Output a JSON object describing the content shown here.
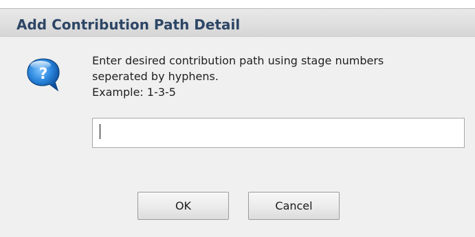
{
  "dialog": {
    "title": "Add Contribution Path Detail",
    "icon": "question-mark-bubble-icon",
    "message": {
      "line1": "Enter desired contribution path using stage numbers",
      "line2": "seperated by hyphens.",
      "example": "Example: 1-3-5"
    },
    "input": {
      "value": "",
      "placeholder": ""
    },
    "buttons": {
      "ok_label": "OK",
      "cancel_label": "Cancel"
    }
  },
  "colors": {
    "title_text": "#2d4665",
    "icon_blue": "#1f7fd6",
    "dialog_background": "#f0f0f0"
  }
}
